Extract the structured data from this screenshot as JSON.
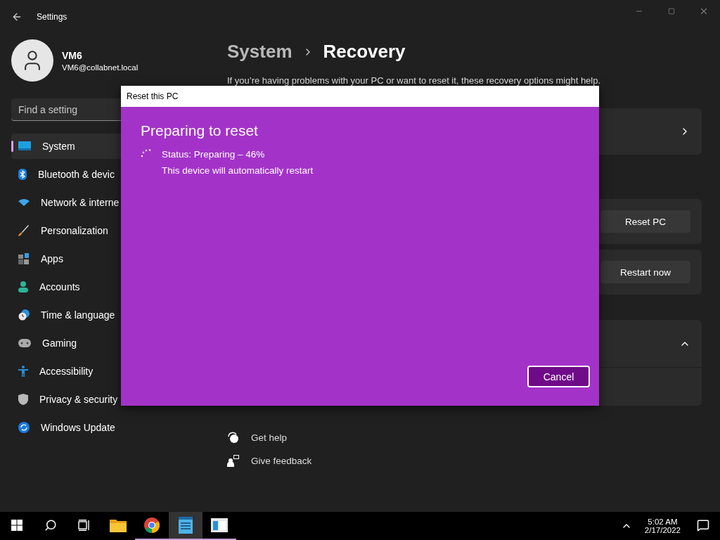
{
  "window": {
    "title": "Settings"
  },
  "user": {
    "name": "VM6",
    "email": "VM6@collabnet.local"
  },
  "search": {
    "placeholder": "Find a setting"
  },
  "sidebar": {
    "items": [
      {
        "label": "System",
        "selected": true
      },
      {
        "label": "Bluetooth & devic",
        "selected": false
      },
      {
        "label": "Network & interne",
        "selected": false
      },
      {
        "label": "Personalization",
        "selected": false
      },
      {
        "label": "Apps",
        "selected": false
      },
      {
        "label": "Accounts",
        "selected": false
      },
      {
        "label": "Time & language",
        "selected": false
      },
      {
        "label": "Gaming",
        "selected": false
      },
      {
        "label": "Accessibility",
        "selected": false
      },
      {
        "label": "Privacy & security",
        "selected": false
      },
      {
        "label": "Windows Update",
        "selected": false
      }
    ]
  },
  "breadcrumb": {
    "parent": "System",
    "current": "Recovery"
  },
  "description": "If you’re having problems with your PC or want to reset it, these recovery options might help.",
  "cards": [
    {
      "kind": "link"
    },
    {
      "kind": "button",
      "button": "Reset PC"
    },
    {
      "kind": "button",
      "button": "Restart now"
    },
    {
      "kind": "expander",
      "expanded": true
    }
  ],
  "help_links": [
    "Get help",
    "Give feedback"
  ],
  "dialog": {
    "title": "Reset this PC",
    "heading": "Preparing to reset",
    "status": "Status: Preparing – 46%",
    "note": "This device will automatically restart",
    "button": "Cancel"
  },
  "taskbar": {
    "apps": [
      {
        "kind": "explorer",
        "running": false,
        "selected": false
      },
      {
        "kind": "chrome",
        "running": true,
        "selected": false
      },
      {
        "kind": "notepad",
        "running": true,
        "selected": true
      },
      {
        "kind": "window",
        "running": true,
        "selected": false
      }
    ],
    "time": "5:02 AM",
    "date": "2/17/2022"
  }
}
